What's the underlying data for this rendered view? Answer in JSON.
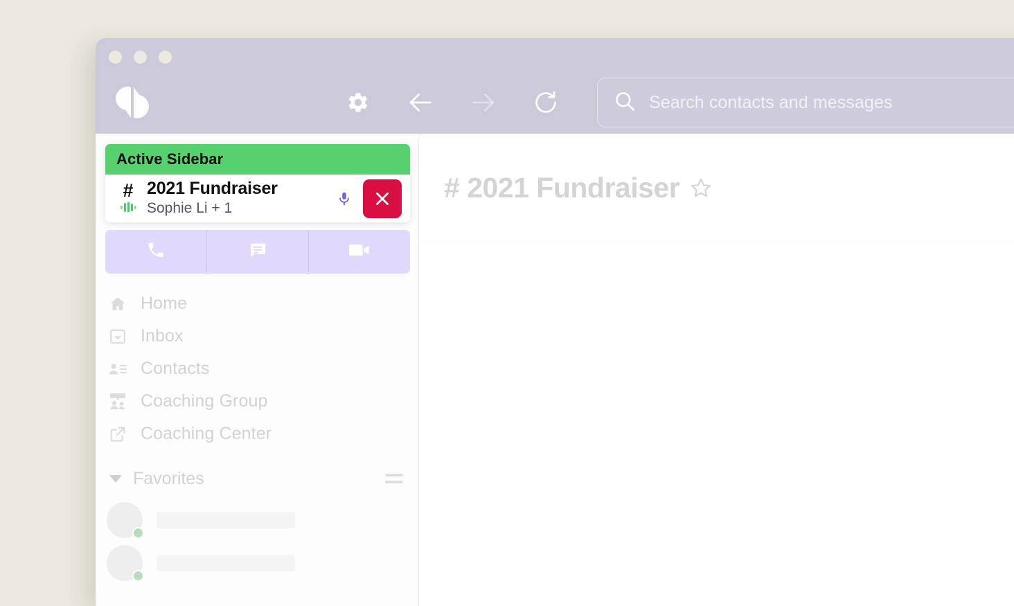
{
  "window": {
    "traffic_lights": [
      "close",
      "minimize",
      "maximize"
    ],
    "logo_name": "dialpad-logo"
  },
  "toolbar": {
    "settings_label": "Settings",
    "back_label": "Back",
    "forward_label": "Forward",
    "reload_label": "Reload"
  },
  "search": {
    "placeholder": "Search contacts and messages",
    "value": ""
  },
  "sidebar": {
    "active_call": {
      "banner_label": "Active Sidebar",
      "channel_prefix": "#",
      "title": "2021 Fundraiser",
      "participants": "Sophie Li + 1",
      "mic_label": "Mute microphone",
      "hangup_label": "End call"
    },
    "quick_actions": [
      {
        "name": "phone-call",
        "label": "Call"
      },
      {
        "name": "message",
        "label": "Message"
      },
      {
        "name": "video-call",
        "label": "Video"
      }
    ],
    "nav_items": [
      {
        "icon": "home-icon",
        "label": "Home"
      },
      {
        "icon": "inbox-icon",
        "label": "Inbox"
      },
      {
        "icon": "contacts-icon",
        "label": "Contacts"
      },
      {
        "icon": "coaching-group-icon",
        "label": "Coaching Group"
      },
      {
        "icon": "coaching-center-icon",
        "label": "Coaching Center"
      }
    ],
    "favorites": {
      "label": "Favorites",
      "expanded": true,
      "sort_label": "Sort favorites",
      "items": [
        {
          "name": "",
          "presence": "online"
        },
        {
          "name": "",
          "presence": "online"
        }
      ]
    }
  },
  "main": {
    "channel_prefix": "#",
    "channel_title": "# 2021 Fundraiser",
    "star_label": "Favorite this channel"
  },
  "colors": {
    "page_background": "#ece9e1",
    "titlebar": "#cbc9da",
    "sidebar": "#fdfdfd",
    "active_banner_green": "#57d06e",
    "hangup_red": "#d80f40",
    "quick_action_lavender": "#e0d9fb",
    "mic_purple": "#7b5cf0",
    "waveform_green": "#5bd07a",
    "muted_text": "#d2d2d2"
  }
}
